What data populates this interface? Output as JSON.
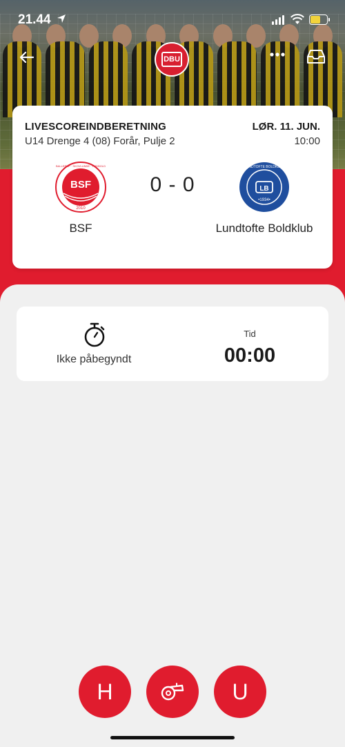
{
  "status_bar": {
    "time": "21.44"
  },
  "header": {
    "back_icon": "arrow-left-icon",
    "more_icon": "more-dots-icon",
    "inbox_icon": "inbox-icon",
    "logo_text": "DBU"
  },
  "match": {
    "title": "LIVESCOREINDBERETNING",
    "league": "U14 Drenge 4 (08) Forår, Pulje 2",
    "date": "LØR. 11. JUN.",
    "time": "10:00",
    "score": "0 - 0",
    "home": {
      "name": "BSF",
      "logo_text": "BSF",
      "logo_ring": "BALLERUP · SKOVLUNDE · FODBOLD",
      "logo_year": "2010"
    },
    "away": {
      "name": "Lundtofte Boldklub",
      "logo_text": "LB",
      "logo_ring": "LUNDTOFTE BOLDKLUB",
      "logo_year": "•1934•"
    }
  },
  "timer": {
    "state_label": "Ikke påbegyndt",
    "time_label": "Tid",
    "clock": "00:00"
  },
  "actions": {
    "home_label": "H",
    "away_label": "U",
    "whistle_icon": "whistle-icon"
  },
  "colors": {
    "accent": "#e01c2e",
    "away_blue": "#1f4e9e",
    "background": "#f0f0f0"
  }
}
